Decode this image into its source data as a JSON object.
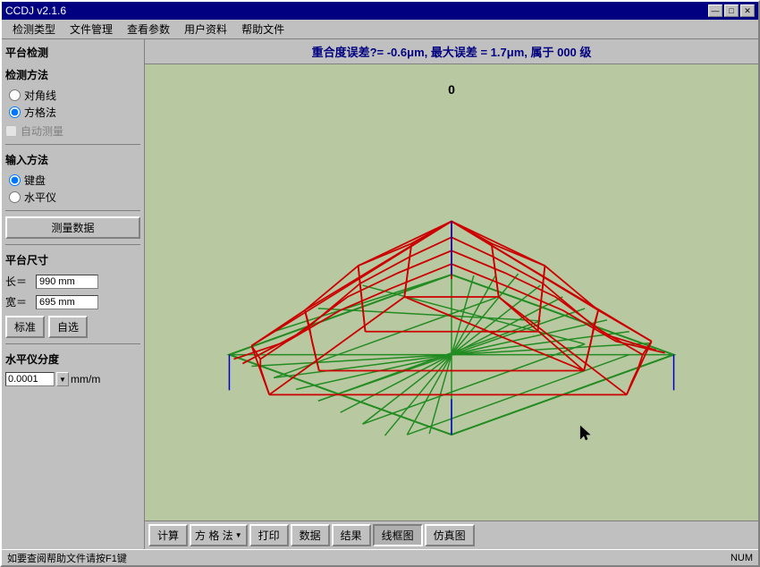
{
  "window": {
    "title": "CCDJ v2.1.6",
    "title_btn_min": "—",
    "title_btn_max": "□",
    "title_btn_close": "✕"
  },
  "menu": {
    "items": [
      "检测类型",
      "文件管理",
      "查看参数",
      "用户资料",
      "帮助文件"
    ]
  },
  "sidebar": {
    "section_platform": "平台检测",
    "section_method": "检测方法",
    "method_options": [
      "对角线",
      "方格法"
    ],
    "method_selected": 1,
    "auto_measure": "自动测量",
    "section_input": "输入方法",
    "input_options": [
      "键盘",
      "水平仪"
    ],
    "input_selected": 0,
    "measure_data_btn": "测量数据",
    "section_size": "平台尺寸",
    "length_label": "长＝",
    "length_value": "990 mm",
    "width_label": "宽＝",
    "width_value": "695 mm",
    "standard_btn": "标准",
    "custom_btn": "自选",
    "section_level": "水平仪分度",
    "level_value": "0.0001",
    "level_unit": "mm/m"
  },
  "result_bar": {
    "text": "重合度误差?= -0.6μm, 最大误差 = 1.7μm, 属于 000 级"
  },
  "toolbar": {
    "calc_btn": "计算",
    "grid_btn": "方 格 法",
    "print_btn": "打印",
    "data_btn": "数据",
    "result_btn": "结果",
    "wireframe_btn": "线框图",
    "sim_btn": "仿真图"
  },
  "status_bar": {
    "help_text": "如要查阅帮助文件请按F1键",
    "num_text": "NUM"
  },
  "chart": {
    "zero_label": "0"
  }
}
